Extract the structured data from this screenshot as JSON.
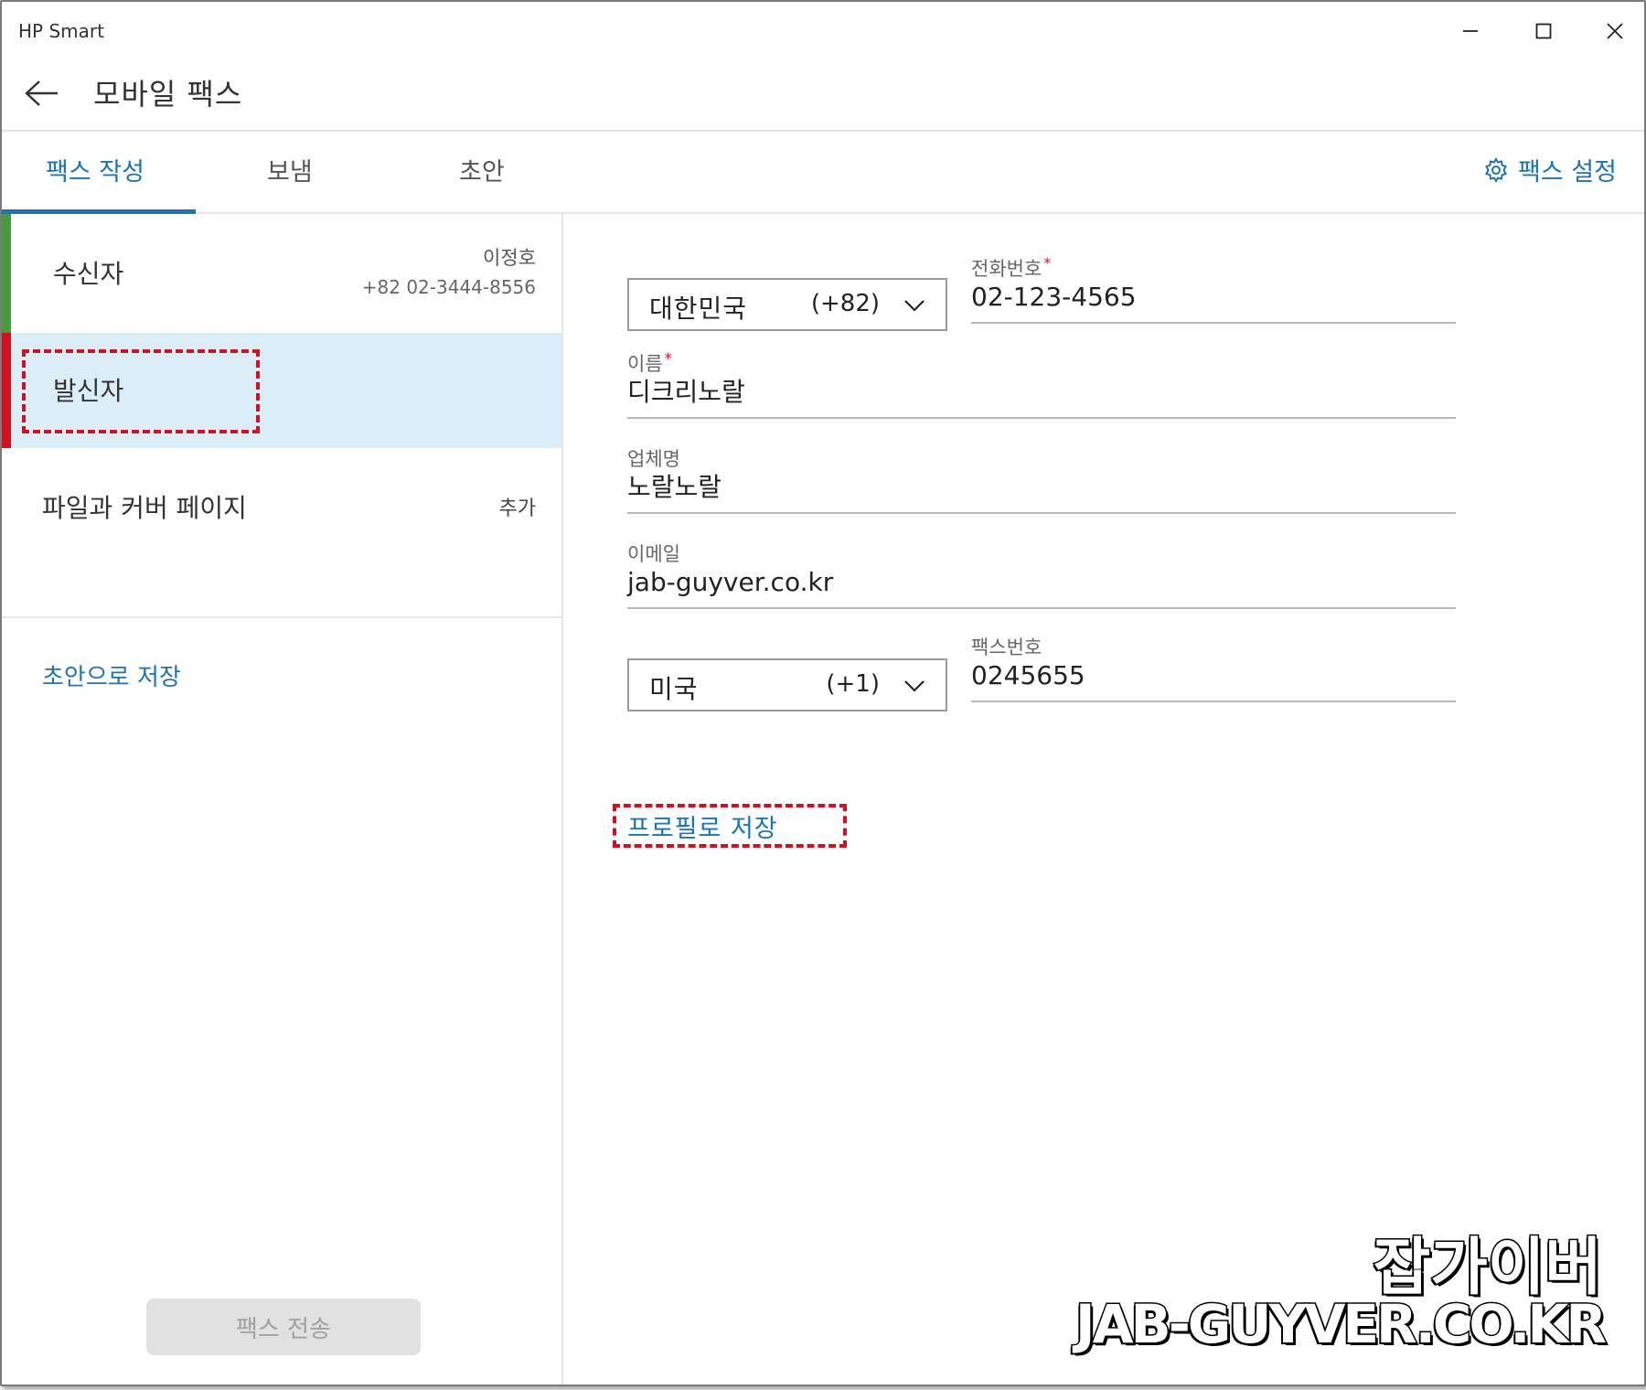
{
  "app": {
    "title": "HP Smart"
  },
  "header": {
    "title": "모바일 팩스"
  },
  "tabs": [
    {
      "label": "팩스 작성",
      "active": true
    },
    {
      "label": "보냄",
      "active": false
    },
    {
      "label": "초안",
      "active": false
    }
  ],
  "fax_settings": {
    "label": "팩스 설정"
  },
  "left": {
    "recipient": {
      "label": "수신자",
      "name": "이정호",
      "phone": "+82 02-3444-8556"
    },
    "sender": {
      "label": "발신자"
    },
    "files": {
      "label": "파일과 커버 페이지",
      "action": "추가"
    },
    "save_draft": "초안으로 저장",
    "send_fax": "팩스 전송"
  },
  "form": {
    "phone_country": {
      "country": "대한민국",
      "code": "(+82)"
    },
    "phone": {
      "label": "전화번호",
      "value": "02-123-4565"
    },
    "name": {
      "label": "이름",
      "value": "디크리노랄"
    },
    "company": {
      "label": "업체명",
      "value": "노랄노랄"
    },
    "email": {
      "label": "이메일",
      "value": "jab-guyver.co.kr"
    },
    "fax_country": {
      "country": "미국",
      "code": "(+1)"
    },
    "fax": {
      "label": "팩스번호",
      "value": "0245655"
    },
    "save_profile": "프로필로 저장",
    "required_mark": "*"
  },
  "watermark": {
    "korean": "잡가이버",
    "english": "JAB-GUYVER.CO.KR"
  },
  "colors": {
    "accent": "#1c74b4",
    "recipient_marker": "#4a9b3f",
    "sender_marker": "#d40f1f",
    "selected_row": "#dbeef8"
  }
}
